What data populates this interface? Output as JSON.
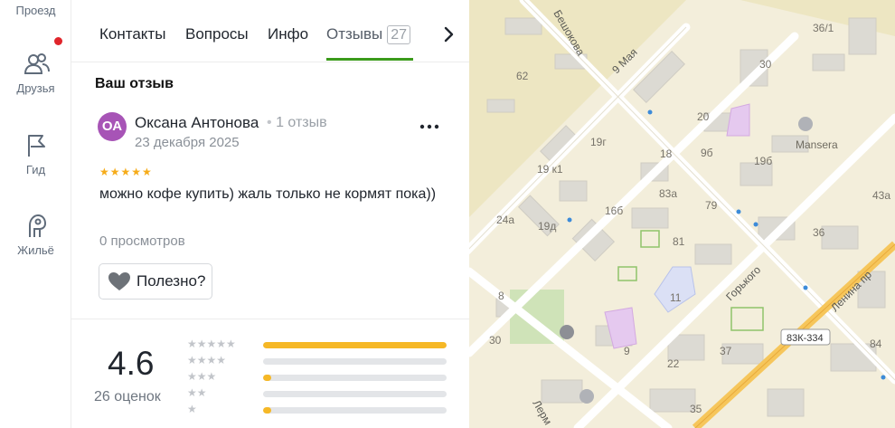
{
  "rail": {
    "items": [
      {
        "label": "Проезд"
      },
      {
        "label": "Друзья"
      },
      {
        "label": "Гид"
      },
      {
        "label": "Жильё"
      }
    ],
    "notification_color": "#e0252b"
  },
  "tabs": {
    "items": [
      {
        "label": "Контакты"
      },
      {
        "label": "Вопросы"
      },
      {
        "label": "Инфо"
      },
      {
        "label": "Отзывы",
        "count": "27"
      }
    ],
    "active": "Отзывы",
    "accent": "#3b9b1b",
    "next_icon": "chevron-right-icon"
  },
  "review_section": {
    "title": "Ваш отзыв",
    "author": {
      "initials": "ОА",
      "name": "Оксана Антонова",
      "meta": "1 отзыв",
      "avatar_color": "#a754b6"
    },
    "date": "23 декабря 2025",
    "stars": "★★★★★",
    "rating": 5,
    "text": "можно кофе купить) жаль только не кормят пока))",
    "views": "0 просмотров",
    "useful_label": "Полезно?",
    "more_icon": "more-dots-icon"
  },
  "summary": {
    "value": "4.6",
    "count_label": "26 оценок",
    "distribution": [
      {
        "stars": "★★★★★",
        "fraction": 1.0
      },
      {
        "stars": "★★★★",
        "fraction": 0.0
      },
      {
        "stars": "★★★",
        "fraction": 0.04
      },
      {
        "stars": "★★",
        "fraction": 0.0
      },
      {
        "stars": "★",
        "fraction": 0.04
      }
    ],
    "bar_color": "#f6b826"
  },
  "map": {
    "streets": [
      "Бешокова",
      "9 Мая",
      "Горького",
      "Ленина пр",
      "Лерм"
    ],
    "poi": [
      "Mansera"
    ],
    "road_badge": "83К-334",
    "numbers": [
      "62",
      "19г",
      "19 к1",
      "18",
      "20",
      "9б",
      "19б",
      "30",
      "36/1",
      "83а",
      "16б",
      "79",
      "24а",
      "19д",
      "81",
      "36",
      "43а",
      "11",
      "8",
      "30",
      "9",
      "37",
      "22",
      "35",
      "84"
    ]
  }
}
